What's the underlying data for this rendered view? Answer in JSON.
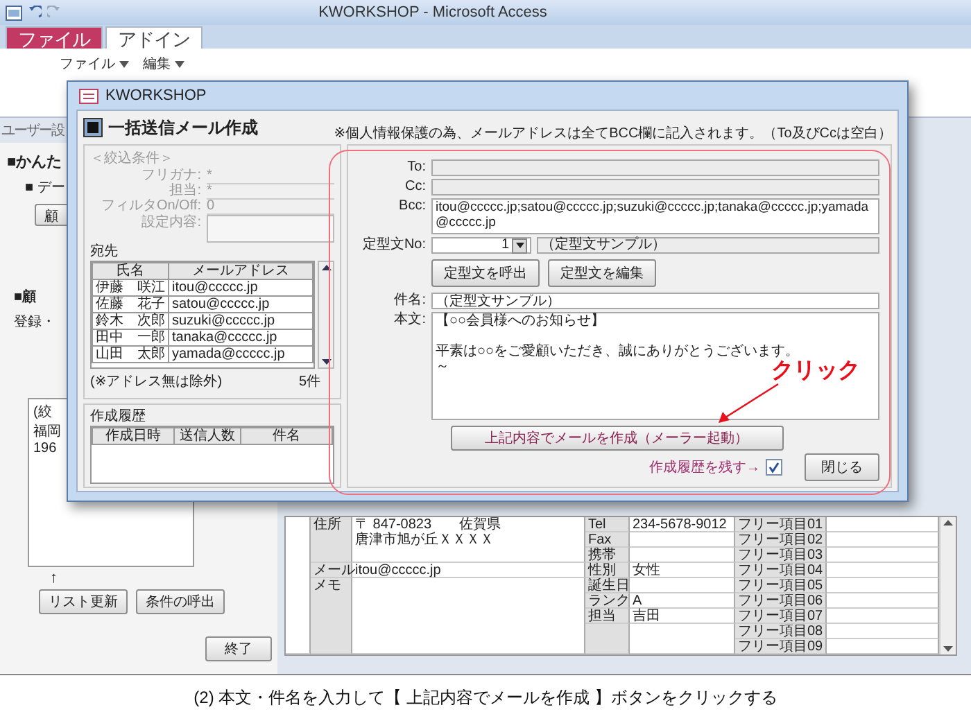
{
  "app": {
    "title": "KWORKSHOP - Microsoft Access",
    "ribbon_tabs": [
      {
        "label": "ファイル",
        "kind": "file",
        "selected": false
      },
      {
        "label": "アドイン",
        "kind": "tab",
        "selected": true
      }
    ],
    "ribbon_menus": [
      "ファイル",
      "編集"
    ],
    "nav_label": "ユーザー設"
  },
  "background_form": {
    "title": "■かんた",
    "section": "■ デー",
    "section_button": "顧",
    "customer_section": "■顧",
    "subtitle": "登録・",
    "filter_lines": [
      "(絞",
      "福岡",
      "196"
    ],
    "arrow": "↑",
    "list_buttons": [
      "リスト更新",
      "条件の呼出"
    ],
    "exit_button": "終了"
  },
  "record": {
    "address_label": "住所",
    "address_lines": [
      "〒 847-0823　　佐賀県",
      "唐津市旭が丘ＸＸＸＸ"
    ],
    "mail_label": "メール",
    "mail": "itou@ccccc.jp",
    "memo_label": "メモ",
    "fields": [
      {
        "label": "Tel",
        "value": "234-5678-9012"
      },
      {
        "label": "Fax"
      },
      {
        "label": "携帯"
      },
      {
        "label": "性別",
        "value": "女性"
      },
      {
        "label": "誕生日"
      },
      {
        "label": "ランク",
        "value": "A"
      },
      {
        "label": "担当",
        "value": "吉田"
      }
    ],
    "free_items": [
      "フリー項目01",
      "フリー項目02",
      "フリー項目03",
      "フリー項目04",
      "フリー項目05",
      "フリー項目06",
      "フリー項目07",
      "フリー項目08",
      "フリー項目09"
    ]
  },
  "dialog": {
    "title": "KWORKSHOP",
    "heading": "一括送信メール作成",
    "note": "※個人情報保護の為、メールアドレスは全てBCC欄に記入されます。（To及びCcは空白）",
    "filter": {
      "heading": "＜絞込条件＞",
      "rows": [
        {
          "label": "フリガナ:",
          "value": "*"
        },
        {
          "label": "担当:",
          "value": "*"
        },
        {
          "label": "フィルタOn/Off:",
          "value": "0"
        }
      ],
      "settings_label": "設定内容:"
    },
    "recipients": {
      "title": "宛先",
      "columns": [
        "氏名",
        "メールアドレス"
      ],
      "rows": [
        [
          "伊藤　咲江",
          "itou@ccccc.jp"
        ],
        [
          "佐藤　花子",
          "satou@ccccc.jp"
        ],
        [
          "鈴木　次郎",
          "suzuki@ccccc.jp"
        ],
        [
          "田中　一郎",
          "tanaka@ccccc.jp"
        ],
        [
          "山田　太郎",
          "yamada@ccccc.jp"
        ]
      ],
      "note": "(※アドレス無は除外)",
      "count": "5件"
    },
    "history": {
      "title": "作成履歴",
      "columns": [
        "作成日時",
        "送信人数",
        "件名"
      ]
    },
    "form": {
      "to_label": "To:",
      "cc_label": "Cc:",
      "bcc_label": "Bcc:",
      "bcc": "itou@ccccc.jp;satou@ccccc.jp;suzuki@ccccc.jp;tanaka@ccccc.jp;yamada@ccccc.jp",
      "template_label": "定型文No:",
      "template_no": "1",
      "template_name": "（定型文サンプル）",
      "template_buttons": [
        "定型文を呼出",
        "定型文を編集"
      ],
      "subject_label": "件名:",
      "subject": "（定型文サンプル）",
      "body_label": "本文:",
      "body_lines": [
        "【○○会員様へのお知らせ】",
        "平素は○○をご愛顧いただき、誠にありがとうございます。",
        "～"
      ],
      "create_button": "上記内容でメールを作成（メーラー起動）",
      "keep_history": {
        "label": "作成履歴を残す→",
        "checked": true
      },
      "close_button": "閉じる"
    }
  },
  "annotation": {
    "text": "クリック"
  },
  "caption": "(2) 本文・件名を入力して【 上記内容でメールを作成 】ボタンをクリックする"
}
